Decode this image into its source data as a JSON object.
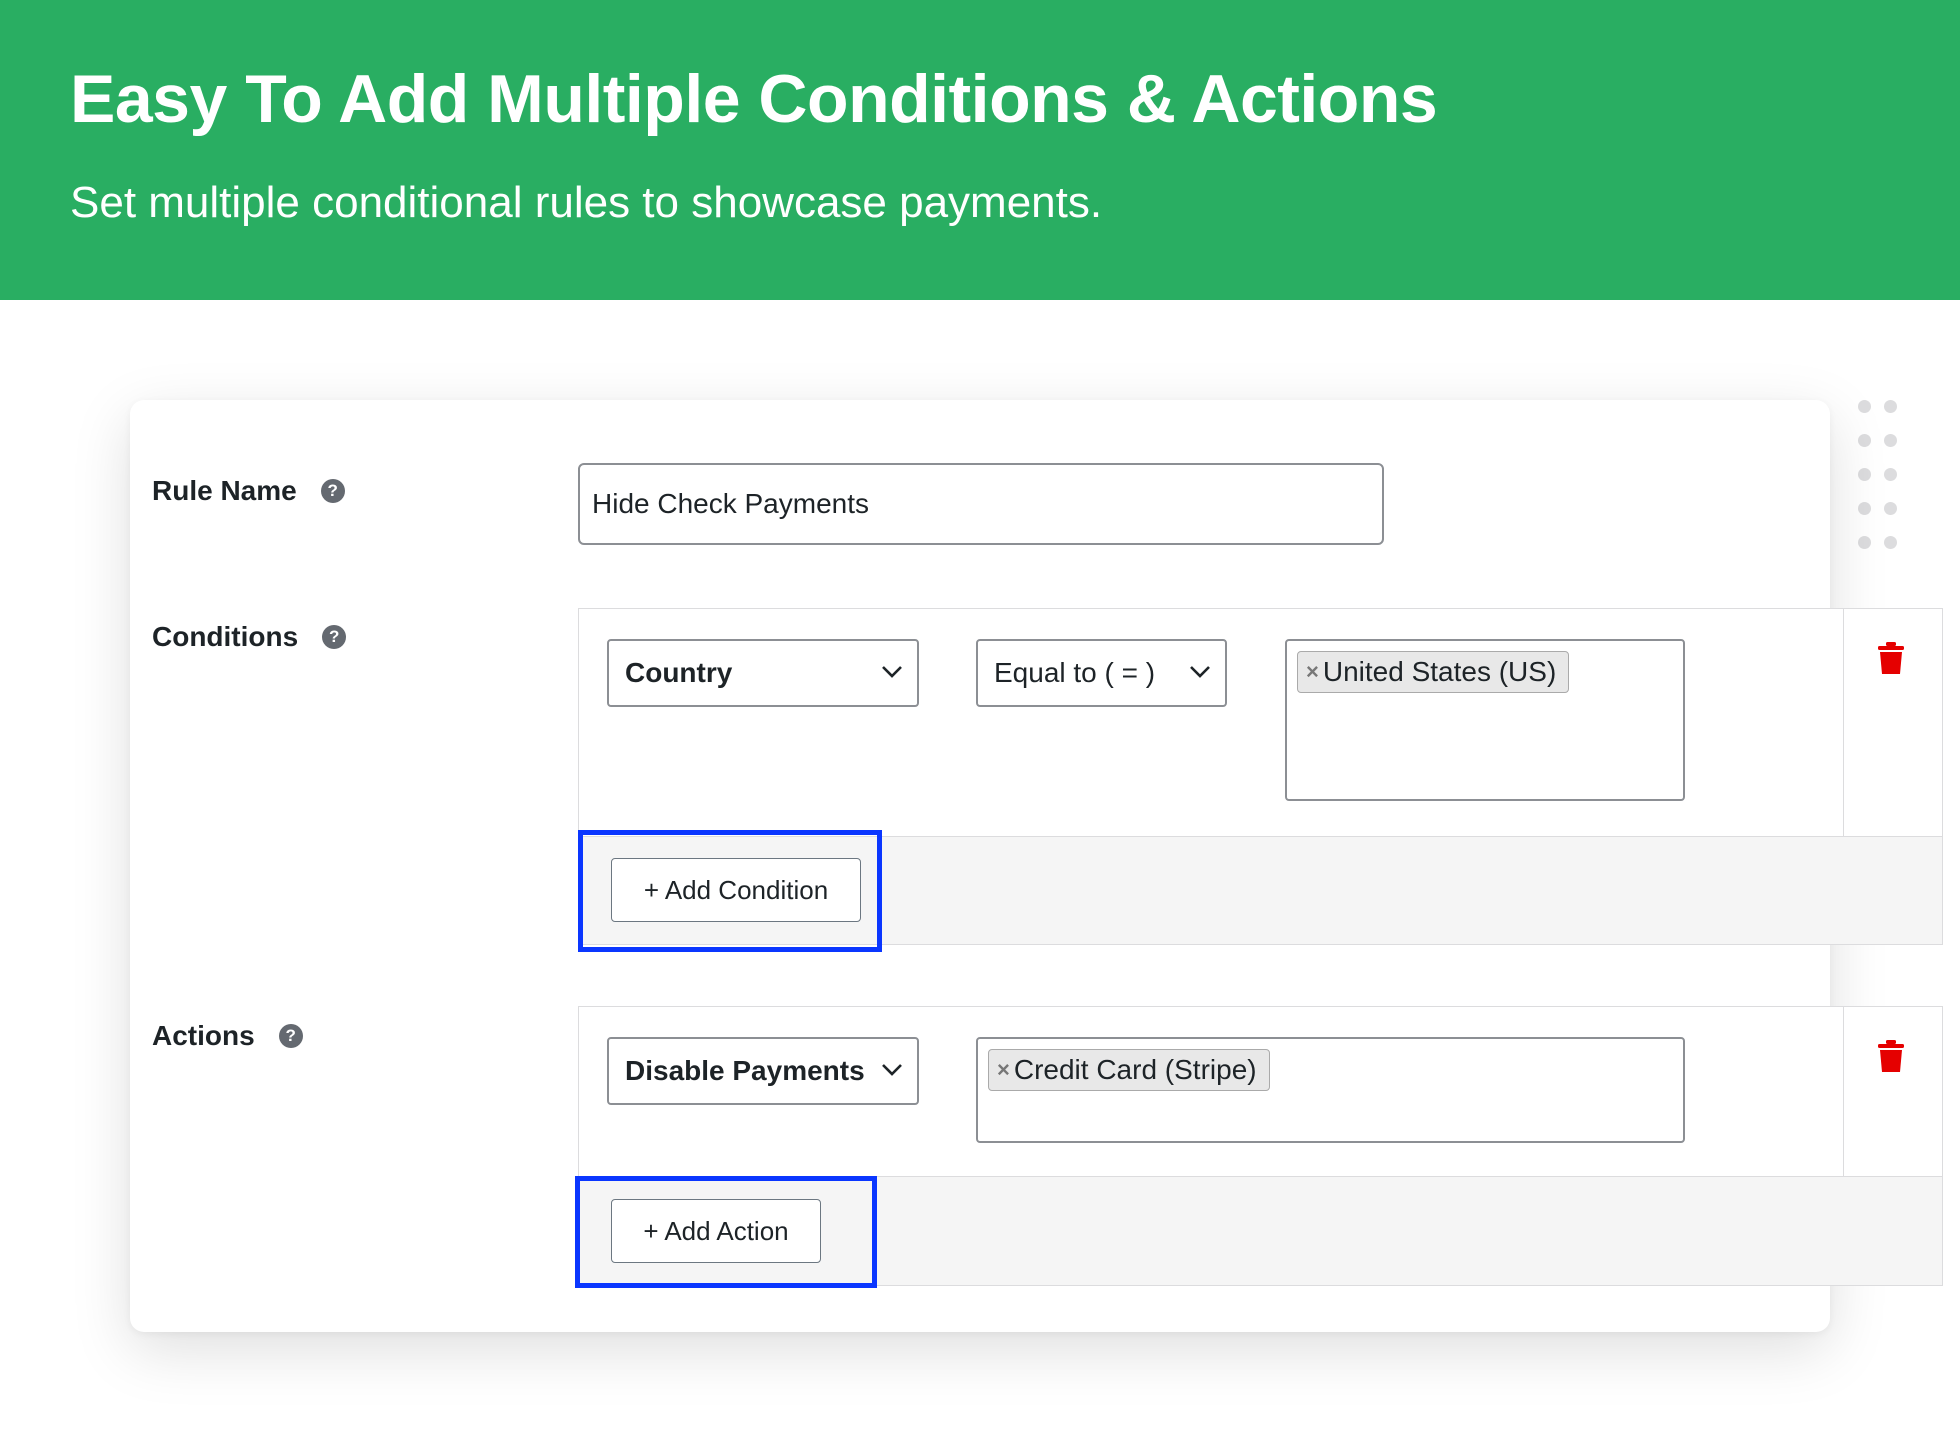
{
  "banner": {
    "title": "Easy To Add Multiple Conditions & Actions",
    "subtitle": "Set multiple conditional rules to showcase payments."
  },
  "form": {
    "rule_name": {
      "label": "Rule Name",
      "help_icon": "question-circle-icon",
      "value": "Hide Check Payments"
    },
    "conditions": {
      "label": "Conditions",
      "help_icon": "question-circle-icon",
      "field_select": "Country",
      "operator_select": "Equal to ( = )",
      "values": [
        "United States (US)"
      ],
      "add_button": "+ Add Condition",
      "delete_icon": "trash-icon"
    },
    "actions": {
      "label": "Actions",
      "help_icon": "question-circle-icon",
      "action_select": "Disable Payments",
      "values": [
        "Credit Card (Stripe)"
      ],
      "add_button": "+ Add Action",
      "delete_icon": "trash-icon"
    }
  },
  "colors": {
    "banner_bg": "#29ae62",
    "highlight": "#0a36ff",
    "delete": "#e50000"
  }
}
